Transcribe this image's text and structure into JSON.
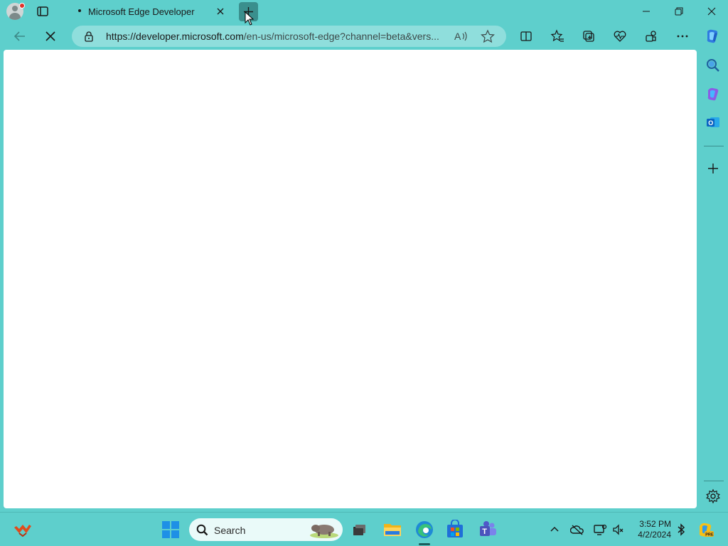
{
  "browser": {
    "tab": {
      "title": "Microsoft Edge Developer"
    },
    "address_bar": {
      "url_host": "https://developer.microsoft.com",
      "url_rest": "/en-us/microsoft-edge?channel=beta&vers..."
    },
    "status": "loading"
  },
  "icons": {
    "profile": "profile-avatar-icon",
    "tab_actions": "tab-actions-icon",
    "new_tab": "plus-icon",
    "back": "back-arrow-icon",
    "stop": "stop-icon",
    "lock": "lock-icon",
    "read_aloud": "read-aloud-icon",
    "favorite": "star-icon",
    "split_screen": "split-screen-icon",
    "favorites": "favorites-icon",
    "collections": "collections-icon",
    "browser_essentials": "heart-pulse-icon",
    "performance": "extensions-icon",
    "more": "more-icon",
    "copilot": "copilot-icon"
  },
  "sidebar": {
    "items": [
      "search-icon",
      "copilot-icon",
      "outlook-icon",
      "add-icon",
      "settings-icon"
    ]
  },
  "taskbar": {
    "search_placeholder": "Search",
    "apps": [
      "start-icon",
      "search-icon",
      "task-view-icon",
      "file-explorer-icon",
      "edge-icon",
      "store-icon",
      "teams-icon"
    ],
    "tray": [
      "chevron-up-icon",
      "onedrive-icon",
      "network-icon",
      "volume-icon",
      "bluetooth-icon",
      "copilot-pre-icon"
    ],
    "clock": {
      "time": "3:52 PM",
      "date": "4/2/2024"
    }
  },
  "colors": {
    "theme": "#5ecfcc",
    "address_bar": "#8fdedc",
    "content": "#ffffff"
  }
}
